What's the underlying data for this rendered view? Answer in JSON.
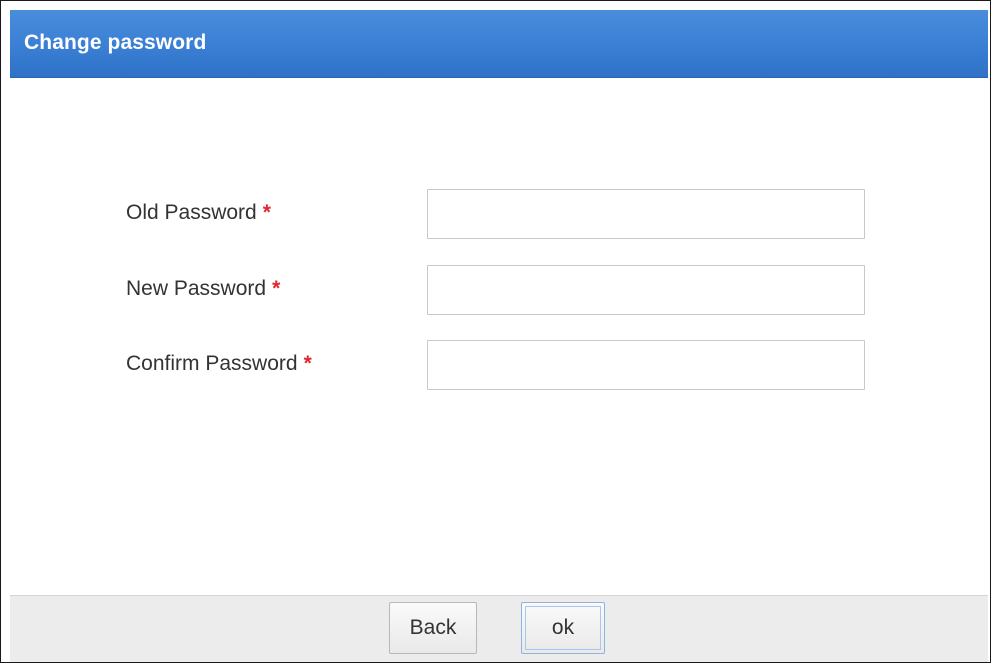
{
  "dialog": {
    "title": "Change password"
  },
  "form": {
    "fields": [
      {
        "label": "Old Password",
        "required_mark": "*",
        "value": ""
      },
      {
        "label": "New Password",
        "required_mark": "*",
        "value": ""
      },
      {
        "label": "Confirm Password",
        "required_mark": "*",
        "value": ""
      }
    ]
  },
  "footer": {
    "back_label": "Back",
    "ok_label": "ok"
  },
  "colors": {
    "title_bar": "#3a7fd4",
    "required": "#e0262e",
    "footer_bg": "#ececec"
  }
}
